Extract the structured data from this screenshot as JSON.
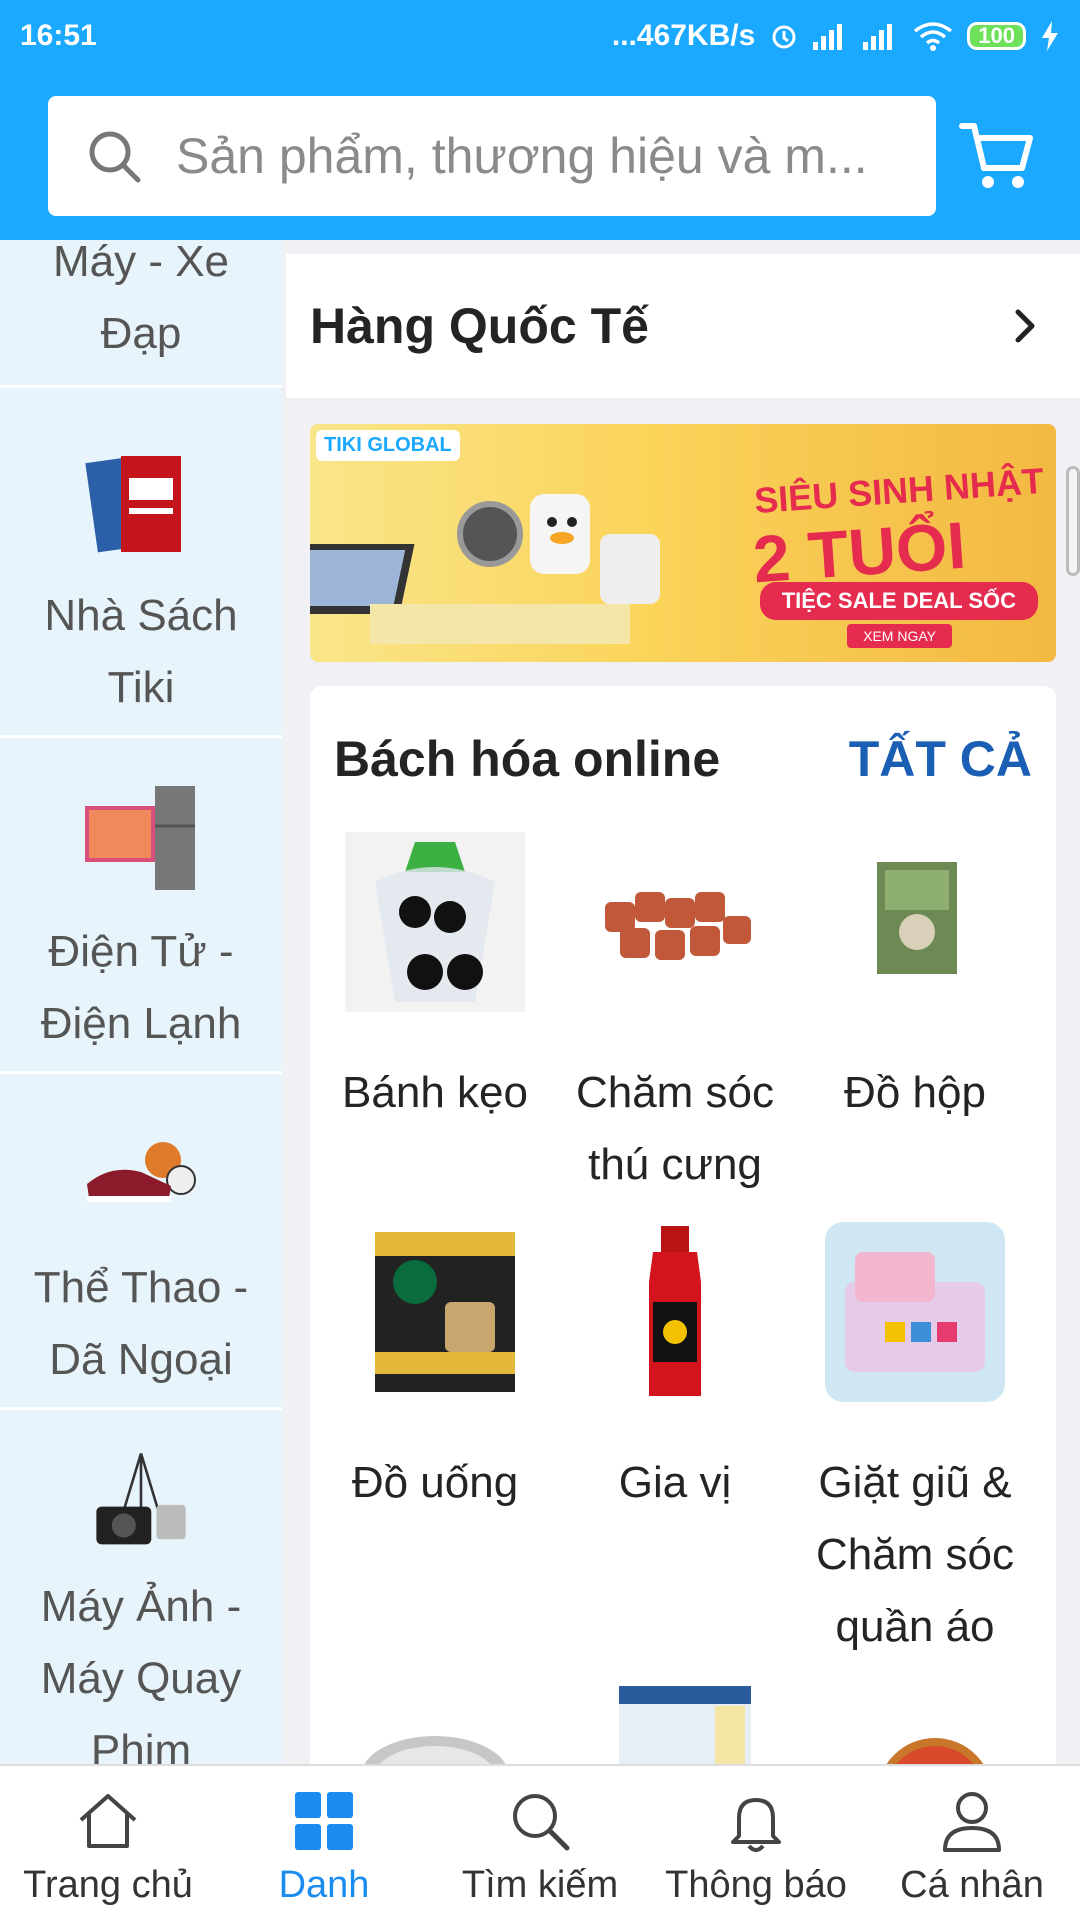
{
  "status_bar": {
    "time": "16:51",
    "network_speed": "...467KB/s",
    "battery": "100"
  },
  "search": {
    "placeholder": "Sản phẩm, thương hiệu và m..."
  },
  "sidebar": {
    "items": [
      {
        "label_line1": "Máy - Xe",
        "label_line2": "Đạp",
        "icon": "bicycle-icon"
      },
      {
        "label_line1": "Nhà Sách",
        "label_line2": "Tiki",
        "icon": "book-icon"
      },
      {
        "label_line1": "Điện Tử -",
        "label_line2": "Điện Lạnh",
        "icon": "tv-fridge-icon"
      },
      {
        "label_line1": "Thể Thao -",
        "label_line2": "Dã Ngoại",
        "icon": "sports-icon"
      },
      {
        "label_line1": "Máy Ảnh -",
        "label_line2": "Máy Quay",
        "label_line3": "Phim",
        "icon": "camera-icon"
      }
    ]
  },
  "content": {
    "intl_title": "Hàng Quốc Tế",
    "banner": {
      "brand": "TIKI GLOBAL",
      "headline1": "SIÊU SINH NHẬT",
      "headline2": "2 TUỔI",
      "subline": "TIỆC SALE DEAL SỐC",
      "cta": "XEM NGAY"
    },
    "grocery": {
      "title": "Bách hóa online",
      "view_all": "TẤT CẢ",
      "items": [
        {
          "line1": "Bánh kẹo",
          "line2": ""
        },
        {
          "line1": "Chăm sóc",
          "line2": "thú cưng"
        },
        {
          "line1": "Đồ hộp",
          "line2": ""
        },
        {
          "line1": "Đồ uống",
          "line2": ""
        },
        {
          "line1": "Gia vị",
          "line2": ""
        },
        {
          "line1": "Giặt giũ &",
          "line2": "Chăm sóc",
          "line3": "quần áo"
        }
      ]
    }
  },
  "bottom_nav": {
    "items": [
      {
        "label": "Trang chủ",
        "icon": "home-icon"
      },
      {
        "label": "Danh",
        "icon": "category-grid-icon"
      },
      {
        "label": "Tìm kiếm",
        "icon": "search-icon"
      },
      {
        "label": "Thông báo",
        "icon": "bell-icon"
      },
      {
        "label": "Cá nhân",
        "icon": "user-icon"
      }
    ]
  },
  "colors": {
    "brand_blue": "#1ba8ff",
    "active_blue": "#1a8cef",
    "link_blue": "#1a5fb4",
    "sidebar_bg": "#e8f4fb"
  }
}
